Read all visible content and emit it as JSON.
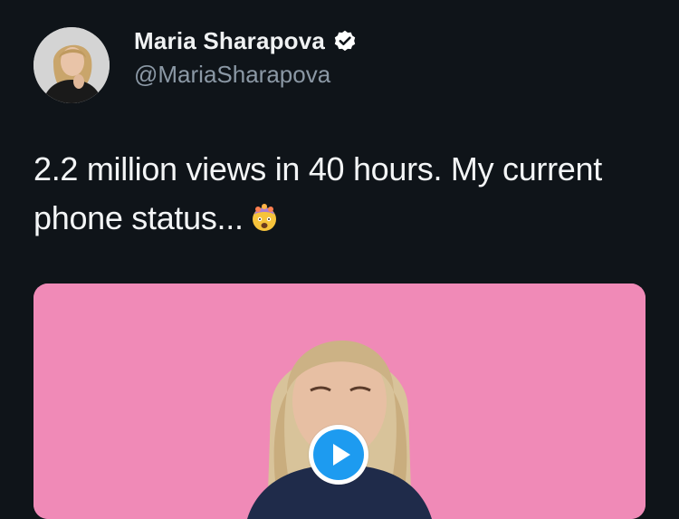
{
  "tweet": {
    "author": {
      "display_name": "Maria Sharapova",
      "handle": "@MariaSharapova",
      "verified": true,
      "avatar_icon": "profile-photo"
    },
    "text": "2.2 million views in 40 hours. My current phone status...",
    "emoji_icon": "exploding-head-emoji",
    "media": {
      "type": "video",
      "background_color": "#f08ab7",
      "play_icon": "play-icon",
      "accent_color": "#1d9bf0"
    }
  },
  "colors": {
    "background": "#0f1419",
    "text": "#e7e9ea",
    "secondary_text": "#8b98a5",
    "verified": "#1d9bf0"
  }
}
